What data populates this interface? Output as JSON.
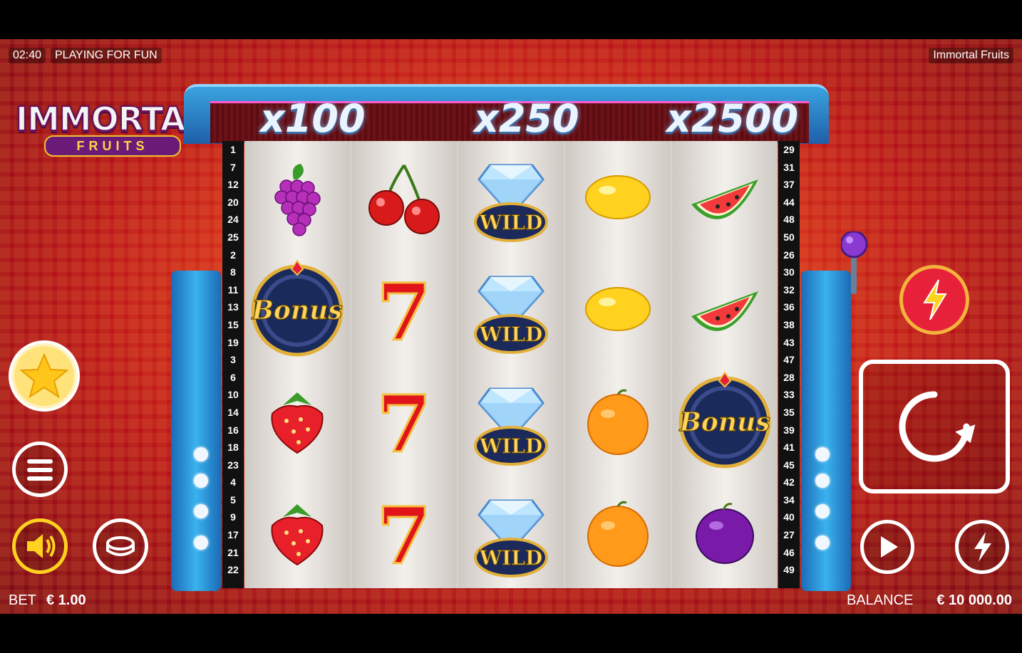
{
  "hud": {
    "clock": "02:40",
    "mode": "PLAYING FOR FUN",
    "game_title": "Immortal Fruits"
  },
  "logo": {
    "line1": "IMMORTAL",
    "line2": "FRUITS"
  },
  "multipliers": [
    "x100",
    "x250",
    "x2500"
  ],
  "paylines_left": [
    "1",
    "7",
    "12",
    "20",
    "24",
    "25",
    "2",
    "8",
    "11",
    "13",
    "15",
    "19",
    "3",
    "6",
    "10",
    "14",
    "16",
    "18",
    "23",
    "4",
    "5",
    "9",
    "17",
    "21",
    "22"
  ],
  "paylines_right": [
    "29",
    "31",
    "37",
    "44",
    "48",
    "50",
    "26",
    "30",
    "32",
    "36",
    "38",
    "43",
    "47",
    "28",
    "33",
    "35",
    "39",
    "41",
    "45",
    "42",
    "34",
    "40",
    "27",
    "46",
    "49"
  ],
  "reels": [
    [
      "grapes",
      "bonus",
      "strawberry",
      "strawberry"
    ],
    [
      "cherry",
      "seven",
      "seven",
      "seven"
    ],
    [
      "wild",
      "wild",
      "wild",
      "wild"
    ],
    [
      "lemon",
      "lemon",
      "orange",
      "orange"
    ],
    [
      "watermelon",
      "watermelon",
      "bonus",
      "plum"
    ]
  ],
  "symbol_labels": {
    "wild": "WILD",
    "bonus": "Bonus",
    "seven": "7"
  },
  "bottom": {
    "bet_label": "BET",
    "bet_value": "€ 1.00",
    "balance_label": "BALANCE",
    "balance_value": "€ 10 000.00"
  },
  "icons": {
    "favorite": "star-lightning-icon",
    "menu": "hamburger-menu-icon",
    "sound": "speaker-icon",
    "bet": "coin-icon",
    "turbo": "lightning-icon",
    "spin": "spin-arrow-icon",
    "autoplay": "play-icon",
    "quickspin": "lightning-icon"
  },
  "colors": {
    "accent_yellow": "#ffd21f",
    "spin_border": "#ffffff"
  }
}
